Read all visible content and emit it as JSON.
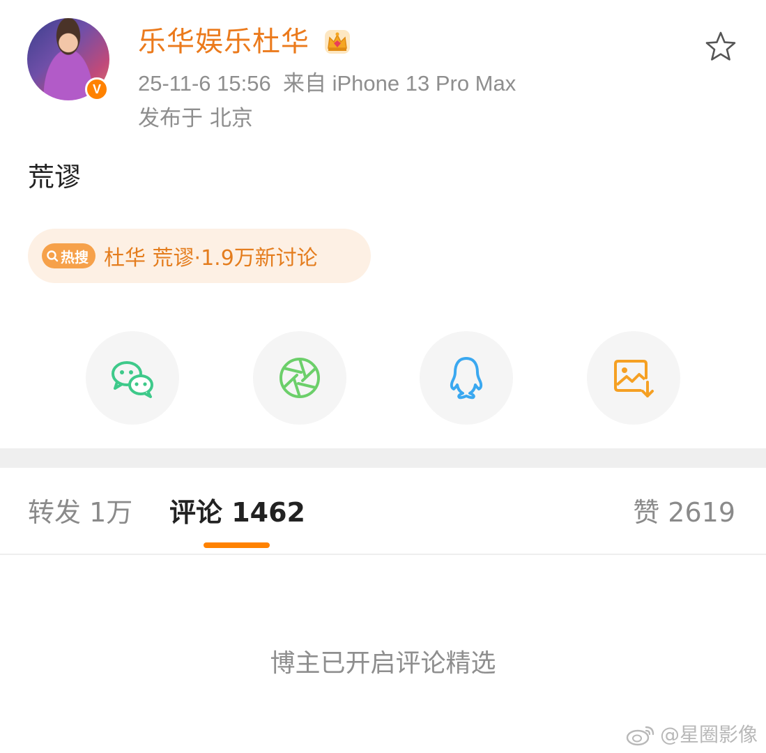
{
  "post": {
    "username": "乐华娱乐杜华",
    "timestamp": "25-11-6 15:56",
    "source": "来自 iPhone 13 Pro Max",
    "location": "发布于 北京",
    "text": "荒谬",
    "verified_badge": "V"
  },
  "hot_search": {
    "tag_label": "热搜",
    "text": "杜华 荒谬·1.9万新讨论"
  },
  "share": {
    "items": [
      "wechat-icon",
      "moments-icon",
      "qq-icon",
      "save-image-icon"
    ]
  },
  "tabs": {
    "repost": "转发 1万",
    "comment": "评论 1462",
    "like": "赞 2619"
  },
  "notice": "博主已开启评论精选",
  "watermark": "@星圈影像",
  "colors": {
    "accent": "#ff8200",
    "username": "#eb7a1c",
    "wechat": "#3ec98a",
    "moments": "#6ccf6a",
    "qq": "#3aa8f0",
    "save": "#f5a023"
  }
}
